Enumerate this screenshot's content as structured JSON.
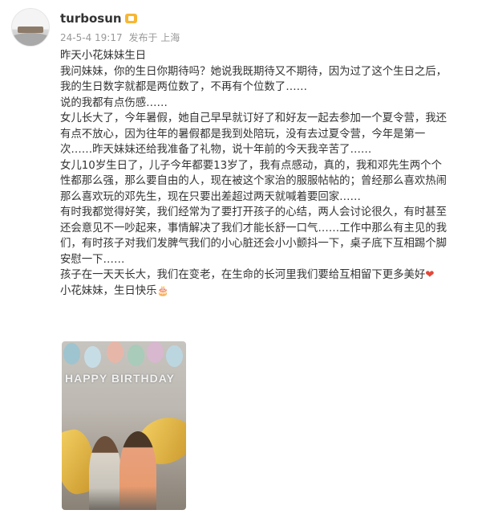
{
  "author": {
    "name": "turbosun"
  },
  "meta": {
    "date": "24-5-4 19:17",
    "location": "发布于 上海"
  },
  "post": {
    "title": "昨天小花妹妹生日",
    "p1": [
      "我问妹妹，你的生日你期待吗？她说我既期待又不期待，因为过了这个生日之后，",
      "我的生日数字就都是两位数了，不再有个位数了……"
    ],
    "p2": "说的我都有点伤感……",
    "p3": [
      "女儿长大了，今年暑假，她自己早早就订好了和好友一起去参加一个夏令营，我还",
      "有点不放心，因为往年的暑假都是我到处陪玩，没有去过夏令营，今年是第一",
      "次……昨天妹妹还给我准备了礼物，说十年前的今天我辛苦了……"
    ],
    "p4": [
      "女儿10岁生日了，儿子今年都要13岁了，我有点感动，真的，我和邓先生两个个",
      "性都那么强，那么要自由的人，现在被这个家治的服服帖帖的；曾经那么喜欢热闹",
      "那么喜欢玩的邓先生，现在只要出差超过两天就喊着要回家……"
    ],
    "p5": [
      "有时我都觉得好笑，我们经常为了要打开孩子的心结，两人会讨论很久，有时甚至",
      "还会意见不一吵起来，事情解决了我们才能长舒一口气……工作中那么有主见的我",
      "们，有时孩子对我们发脾气我们的小心脏还会小小颤抖一下，桌子底下互相踢个脚",
      "安慰一下……"
    ],
    "p6": "孩子在一天天长大，我们在变老，在生命的长河里我们要给互相留下更多美好",
    "p7": "小花妹妹，生日快乐"
  },
  "photo": {
    "banner_text": "HAPPY BIRTHDAY"
  },
  "icons": {
    "badge": "vip-badge-icon",
    "heart": "heart-emoji-icon",
    "cake": "cake-emoji-icon"
  },
  "colors": {
    "meta": "#999999",
    "text": "#333333",
    "heart": "#e2483b"
  }
}
